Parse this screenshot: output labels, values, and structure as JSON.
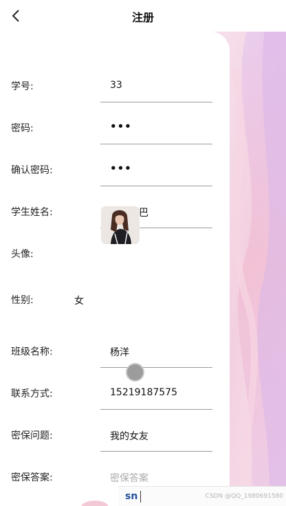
{
  "header": {
    "title": "注册"
  },
  "form": {
    "student_id": {
      "label": "学号:",
      "value": "33"
    },
    "password": {
      "label": "密码:",
      "value": "•••"
    },
    "confirm_password": {
      "label": "确认密码:",
      "value": "•••"
    },
    "student_name": {
      "label": "学生姓名:",
      "value": "迪丽热巴"
    },
    "avatar": {
      "label": "头像:"
    },
    "gender": {
      "label": "性别:",
      "value": "女"
    },
    "class_name": {
      "label": "班级名称:",
      "value": "杨洋"
    },
    "contact": {
      "label": "联系方式:",
      "value": "15219187575"
    },
    "security_question": {
      "label": "密保问题:",
      "value": "我的女友"
    },
    "security_answer": {
      "label": "密保答案:",
      "placeholder": "密保答案"
    }
  },
  "ime": {
    "composition": "sn"
  },
  "watermark": "CSDN @QQ_1980691580",
  "colors": {
    "accent_pink": "#f4c7d6",
    "accent_lavender": "#e2c8ec",
    "underline": "#9a9a9a"
  }
}
